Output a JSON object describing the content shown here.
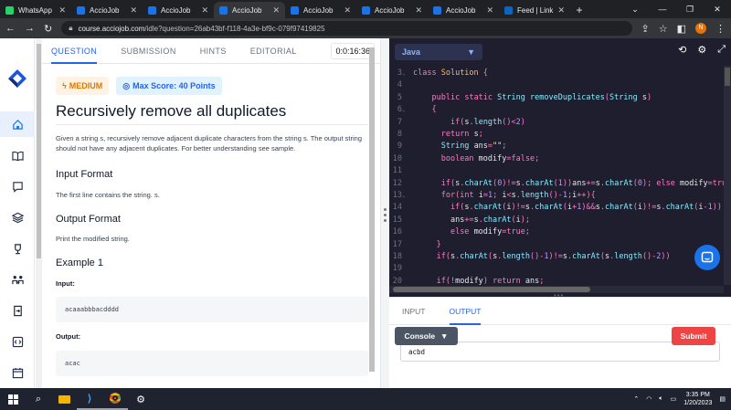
{
  "browser": {
    "tabs": [
      {
        "title": "WhatsApp",
        "color": "#25d366",
        "active": false
      },
      {
        "title": "AccioJob",
        "color": "#1a73e8",
        "active": false
      },
      {
        "title": "AccioJob",
        "color": "#1a73e8",
        "active": false
      },
      {
        "title": "AccioJob",
        "color": "#1a73e8",
        "active": true
      },
      {
        "title": "AccioJob",
        "color": "#1a73e8",
        "active": false
      },
      {
        "title": "AccioJob",
        "color": "#1a73e8",
        "active": false
      },
      {
        "title": "AccioJob",
        "color": "#1a73e8",
        "active": false
      },
      {
        "title": "Feed | LinkedIn",
        "color": "#0a66c2",
        "active": false
      }
    ],
    "url_host": "course.acciojob.com",
    "url_path": "/idle?question=26ab43bf-f118-4a3e-bf9c-079f97419825",
    "profile_initial": "N"
  },
  "question_tabs": [
    "QUESTION",
    "SUBMISSION",
    "HINTS",
    "EDITORIAL"
  ],
  "timer": "0:0:16:36",
  "difficulty": "MEDIUM",
  "max_score": "Max Score: 40 Points",
  "title": "Recursively remove all duplicates",
  "description": "Given a string s, recursively remove adjacent duplicate characters from the string s. The output string should not have any adjacent duplicates. For better understanding see sample.",
  "input_format_heading": "Input Format",
  "input_format_text": "The first line contains the string. s.",
  "output_format_heading": "Output Format",
  "output_format_text": "Print the modified string.",
  "example_heading": "Example 1",
  "input_label": "Input:",
  "example_input": "acaaabbbacdddd",
  "output_label": "Output:",
  "example_output": "acac",
  "editor": {
    "language": "Java",
    "lines": [
      {
        "n": "3",
        "fold": true,
        "text": "class Solution {"
      },
      {
        "n": "4",
        "fold": false,
        "text": ""
      },
      {
        "n": "5",
        "fold": false,
        "text": "    public static String removeDuplicates(String s)"
      },
      {
        "n": "6",
        "fold": true,
        "text": "    {"
      },
      {
        "n": "7",
        "fold": false,
        "text": "        if(s.length()<2)"
      },
      {
        "n": "8",
        "fold": false,
        "text": "      return s;"
      },
      {
        "n": "9",
        "fold": false,
        "text": "      String ans=\"\";"
      },
      {
        "n": "10",
        "fold": false,
        "text": "      boolean modify=false;"
      },
      {
        "n": "11",
        "fold": false,
        "text": ""
      },
      {
        "n": "12",
        "fold": false,
        "text": "      if(s.charAt(0)!=s.charAt(1))ans+=s.charAt(0); else modify=true;"
      },
      {
        "n": "13",
        "fold": true,
        "text": "      for(int i=1; i<s.length()-1;i++){"
      },
      {
        "n": "14",
        "fold": false,
        "text": "        if(s.charAt(i)!=s.charAt(i+1)&&s.charAt(i)!=s.charAt(i-1))"
      },
      {
        "n": "15",
        "fold": false,
        "text": "        ans+=s.charAt(i);"
      },
      {
        "n": "16",
        "fold": false,
        "text": "        else modify=true;"
      },
      {
        "n": "17",
        "fold": false,
        "text": "     }"
      },
      {
        "n": "18",
        "fold": false,
        "text": "     if(s.charAt(s.length()-1)!=s.charAt(s.length()-2))"
      },
      {
        "n": "19",
        "fold": false,
        "text": ""
      },
      {
        "n": "20",
        "fold": false,
        "text": "     if(!modify) return ans;"
      }
    ]
  },
  "io_tabs": [
    "INPUT",
    "OUTPUT"
  ],
  "output_value": "acbd",
  "console_label": "Console",
  "submit_label": "Submit",
  "taskbar": {
    "time": "3:35 PM",
    "date": "1/20/2023"
  }
}
